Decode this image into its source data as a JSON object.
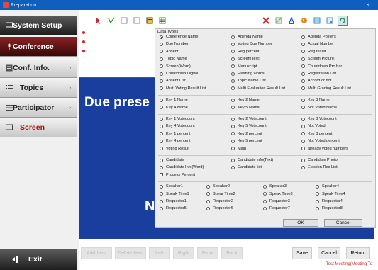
{
  "window": {
    "title": "Preparation",
    "close_glyph": "×"
  },
  "sidebar": {
    "items": [
      {
        "label": "System Setup",
        "icon": "monitor-icon",
        "arrow": ""
      },
      {
        "label": "Conference",
        "icon": "microphone-icon",
        "arrow": ""
      },
      {
        "label": "Conf. Info.",
        "icon": "info-panel-icon",
        "arrow": "›"
      },
      {
        "label": "Topics",
        "icon": "list-icon",
        "arrow": "›"
      },
      {
        "label": "Participator",
        "icon": "participants-icon",
        "arrow": "›"
      },
      {
        "label": "Screen",
        "icon": "screen-icon",
        "arrow": ""
      }
    ],
    "exit_label": "Exit"
  },
  "content": {
    "heading": "Due prese",
    "bottom_text": "N"
  },
  "dialog": {
    "title": "Data Types",
    "group1": [
      [
        "Conference Name",
        "Agenda Name",
        "Agenda Posters"
      ],
      [
        "Due Number",
        "Voting Due Number",
        "Actual Number"
      ],
      [
        "Absent",
        "Reg percent",
        "Reg result"
      ],
      [
        "Topic Name",
        "Screen(Text)",
        "Screen(Picture)"
      ],
      [
        "Screen(Word)",
        "Manuscript",
        "Countdown Pro bar"
      ],
      [
        "Countdown Digital",
        "Flashing words",
        "Registration List"
      ],
      [
        "Absent List",
        "Topic Name List",
        "Accord or not"
      ],
      [
        "Multi Voting Result List",
        "Multi Evaluation Result List",
        "Multi Grading Result List"
      ]
    ],
    "group2": [
      [
        "Key 1 Name",
        "Key 2 Name",
        "Key 3 Name"
      ],
      [
        "Key 4 Name",
        "Key 5 Name",
        "Not Voted Name"
      ]
    ],
    "group3": [
      [
        "Key 1 Votecount",
        "Key 2 Votecount",
        "Key 3 Votecount"
      ],
      [
        "Key 4 Votecount",
        "Key 5 Votecount",
        "Not Voted"
      ],
      [
        "Key 1 percent",
        "Key 2 percent",
        "Key 3 percent"
      ],
      [
        "Key 4 percent",
        "Key 5 percent",
        "Not Voted percent"
      ],
      [
        "Voting Result",
        "Main",
        "already voted numbers"
      ]
    ],
    "group4": [
      [
        "Candidate",
        "Candidate info(Text)",
        "Candidate Photo"
      ],
      [
        "Candidate Info(Word)",
        "Candidate list",
        "Election Res List"
      ]
    ],
    "checkbox_label": "Process Percent",
    "group5": [
      [
        "Speaker1",
        "Speaker2",
        "Speaker3",
        "Speaker4"
      ],
      [
        "Speak Time1",
        "Spear Time2",
        "Speak Time3",
        "Speak Time4"
      ],
      [
        "Requestor1",
        "Requestor2",
        "Requestor3",
        "Requestor4"
      ],
      [
        "Requestor5",
        "Requestor6",
        "Requestor7",
        "Requestor8"
      ]
    ],
    "ok_label": "OK",
    "cancel_label": "Cancel"
  },
  "bottombar": {
    "disabled_buttons": [
      "Add Item",
      "Delete Item",
      "Left",
      "Right",
      "Front",
      "Back"
    ],
    "save_label": "Save",
    "cancel_label": "Cancel",
    "return_label": "Return"
  },
  "status": {
    "text": "Test Meeting(Meeting To"
  }
}
